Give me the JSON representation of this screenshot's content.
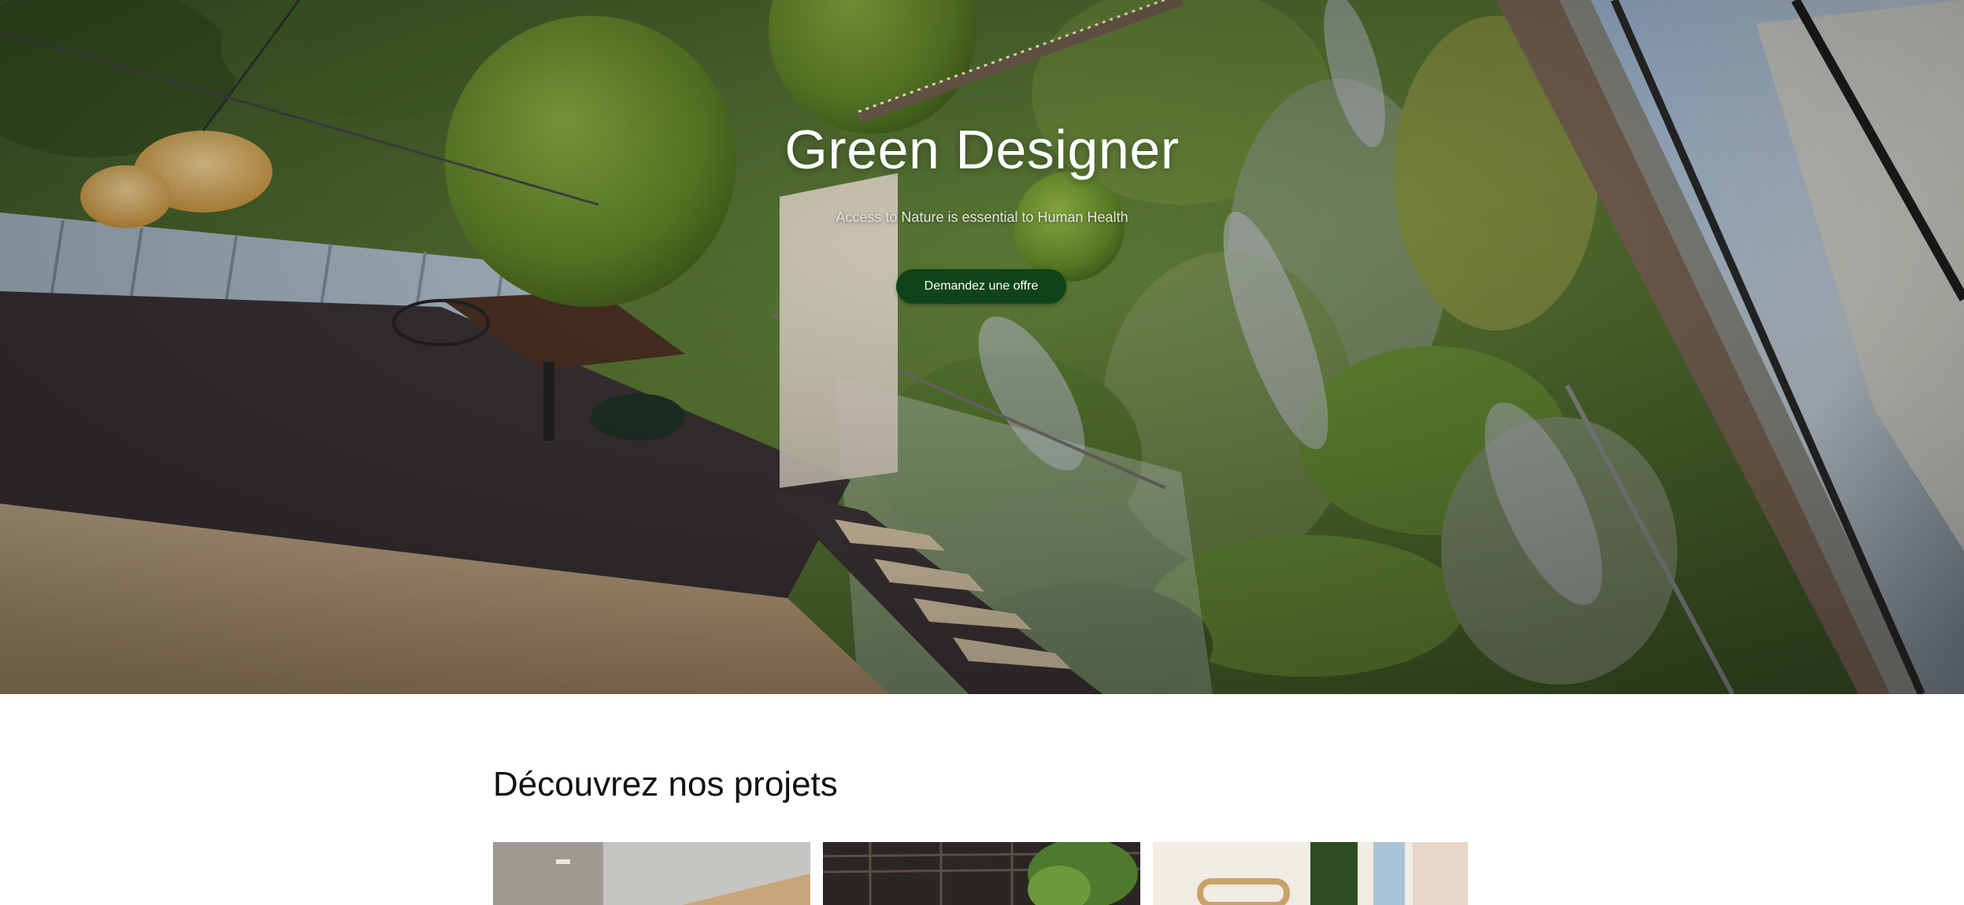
{
  "hero": {
    "title": "Green Designer",
    "subtitle": "Access to Nature is essential to Human Health",
    "cta_label": "Demandez une offre",
    "cta_color": "#0f4418"
  },
  "projects": {
    "heading": "Découvrez nos projets",
    "cards": [
      {
        "name": "project-card-1"
      },
      {
        "name": "project-card-2"
      },
      {
        "name": "project-card-3"
      }
    ]
  }
}
